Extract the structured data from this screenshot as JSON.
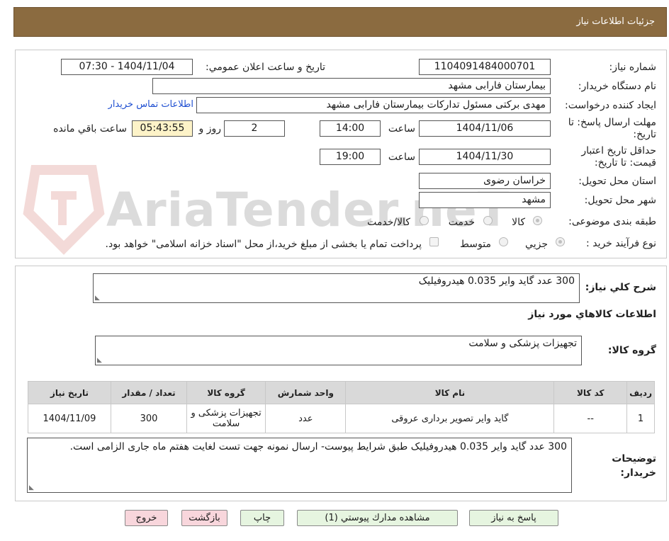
{
  "header": {
    "title": "جزئیات اطلاعات نیاز"
  },
  "form": {
    "need_number_label": "شماره نیاز:",
    "need_number": "1104091484000701",
    "announce_label": "تاریخ و ساعت اعلان عمومي:",
    "announce_value": "1404/11/04 - 07:30",
    "buyer_label": "نام دستگاه خریدار:",
    "buyer_value": "بیمارستان فارابی مشهد",
    "creator_label": "ایجاد کننده درخواست:",
    "creator_value": "مهدی برکتی مسئول تداركات بیمارستان فارابی مشهد",
    "contact_link": "اطلاعات تماس خریدار",
    "deadline_label": "مهلت ارسال پاسخ: تا تاریخ:",
    "deadline_date": "1404/11/06",
    "hour_label": "ساعت",
    "deadline_time": "14:00",
    "days_value": "2",
    "days_label": "روز و",
    "remaining_time": "05:43:55",
    "remaining_label": "ساعت باقي مانده",
    "validity_label": "حداقل تاریخ اعتبار قیمت: تا تاریخ:",
    "validity_date": "1404/11/30",
    "validity_hour_label": "ساعت",
    "validity_time": "19:00",
    "province_label": "استان محل تحویل:",
    "province_value": "خراسان رضوی",
    "city_label": "شهر محل تحویل:",
    "city_value": "مشهد",
    "category_label": "طبقه بندی موضوعی:",
    "category_options": [
      "کالا",
      "خدمت",
      "کالا/خدمت"
    ],
    "process_label": "نوع فرآیند خرید :",
    "process_options": [
      "جزیي",
      "متوسط"
    ],
    "payment_note": "پرداخت تمام یا بخشی از مبلغ خرید،از محل \"اسناد خزانه اسلامی\" خواهد بود."
  },
  "summary": {
    "label": "شرح كلي نياز:",
    "value": "300 عدد گاید وایر 0.035 هیدروفیلیک",
    "goods_heading": "اطلاعات کالاهاي مورد نياز",
    "group_label": "گروه کالا:",
    "group_value": "تجهیزات پزشکی و سلامت"
  },
  "table": {
    "headers": [
      "رديف",
      "کد کالا",
      "نام کالا",
      "واحد شمارش",
      "گروه کالا",
      "تعداد / مقدار",
      "تاریخ نیاز"
    ],
    "rows": [
      {
        "row": "1",
        "code": "--",
        "name": "گاید وایر تصویر برداری عروقی",
        "unit": "عدد",
        "group": "تجهیزات پزشکی و سلامت",
        "qty": "300",
        "date": "1404/11/09"
      }
    ]
  },
  "buyer_notes": {
    "label": "توضيحات خريدار:",
    "value": "300 عدد گاید وایر 0.035 هیدروفیلیک طبق شرایط پیوست- ارسال نمونه جهت تست لغایت هفتم ماه جاری الزامی است."
  },
  "buttons": {
    "reply": "پاسخ به نياز",
    "documents": "مشاهده مدارك پيوستي (1)",
    "print": "چاپ",
    "back": "بازگشت",
    "exit": "خروج"
  },
  "watermark": {
    "text": "AriaTender.neT"
  },
  "colors": {
    "header_bg": "#8b6b40",
    "link": "#1f4fd1",
    "remaining_bg": "#fdf3c8"
  }
}
